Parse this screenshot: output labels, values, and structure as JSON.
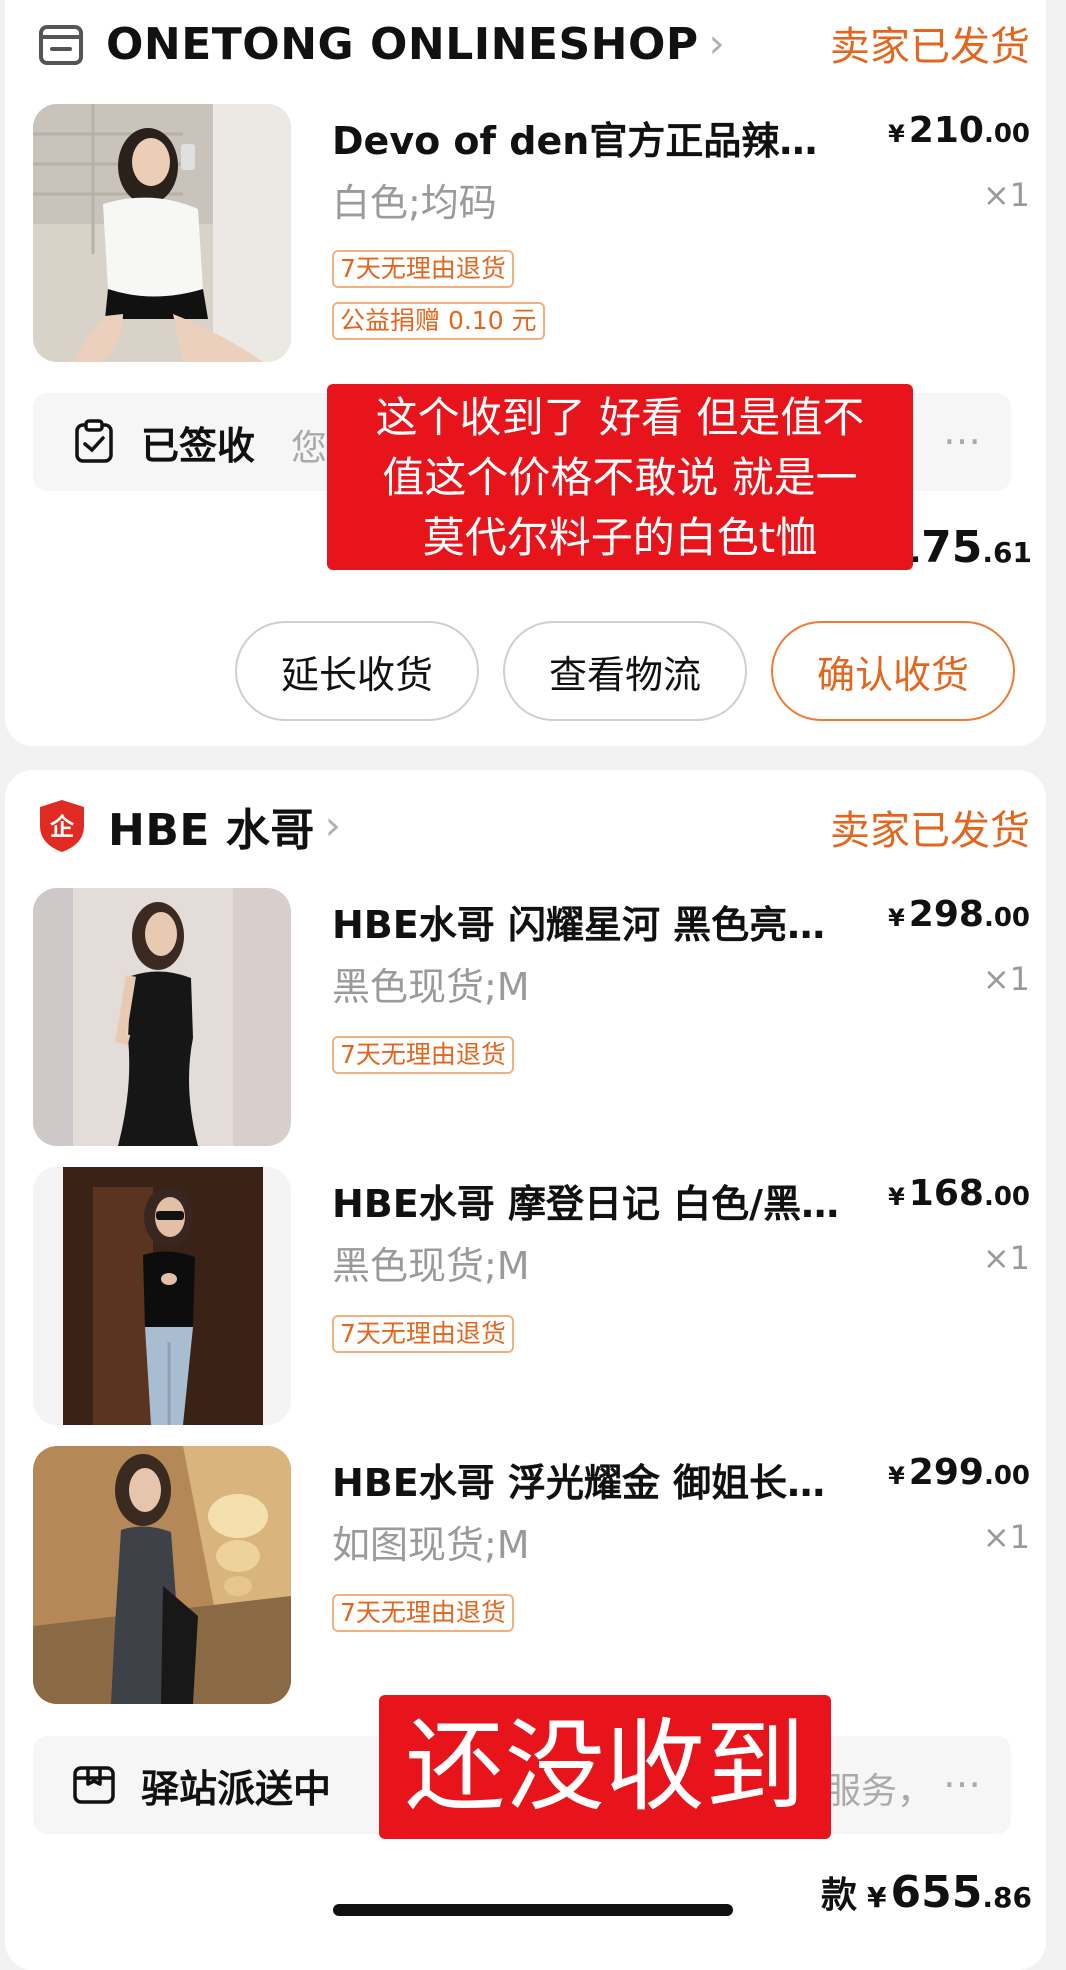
{
  "colors": {
    "accent": "#e4661e",
    "overlay_red": "#e8141b",
    "background": "#f2f2f2"
  },
  "order1": {
    "shop_icon": "store-icon",
    "shop_name": "ONETONG ONLINESHOP",
    "chevron": "›",
    "status": "卖家已发货",
    "items": [
      {
        "title": "Devo of den官方正品辣妹…",
        "price_symbol": "¥",
        "price_int": "210",
        "price_dec": ".00",
        "spec": "白色;均码",
        "qty": "×1",
        "tags": [
          "7天无理由退货",
          "公益捐赠 0.10 元"
        ]
      }
    ],
    "logistics": {
      "icon": "clipboard-check-icon",
      "status": "已签收",
      "detail_fragment": "您",
      "more": "…"
    },
    "total": {
      "int_visible": "175",
      "dec": ".61"
    },
    "overlay_text": [
      "这个收到了 好看 但是值不",
      "值这个价格不敢说 就是一",
      "莫代尔料子的白色t恤"
    ],
    "buttons": {
      "extend": "延长收货",
      "track": "查看物流",
      "confirm": "确认收货"
    }
  },
  "order2": {
    "shop_icon": "shield-qi-icon",
    "shop_icon_char": "企",
    "shop_name": "HBE 水哥",
    "chevron": "›",
    "status": "卖家已发货",
    "items": [
      {
        "title": "HBE水哥 闪耀星河 黑色亮…",
        "price_symbol": "¥",
        "price_int": "298",
        "price_dec": ".00",
        "spec": "黑色现货;M",
        "qty": "×1",
        "tags": [
          "7天无理由退货"
        ]
      },
      {
        "title": "HBE水哥 摩登日记 白色/黑…",
        "price_symbol": "¥",
        "price_int": "168",
        "price_dec": ".00",
        "spec": "黑色现货;M",
        "qty": "×1",
        "tags": [
          "7天无理由退货"
        ]
      },
      {
        "title": "HBE水哥 浮光耀金 御姐长…",
        "price_symbol": "¥",
        "price_int": "299",
        "price_dec": ".00",
        "spec": "如图现货;M",
        "qty": "×1",
        "tags": [
          "7天无理由退货"
        ]
      }
    ],
    "logistics": {
      "icon": "package-box-icon",
      "status": "驿站派送中",
      "detail_fragment": "服务，",
      "more": "…"
    },
    "total": {
      "label": "款",
      "symbol": "¥",
      "int": "655",
      "dec": ".86"
    },
    "overlay_text": "还没收到"
  }
}
